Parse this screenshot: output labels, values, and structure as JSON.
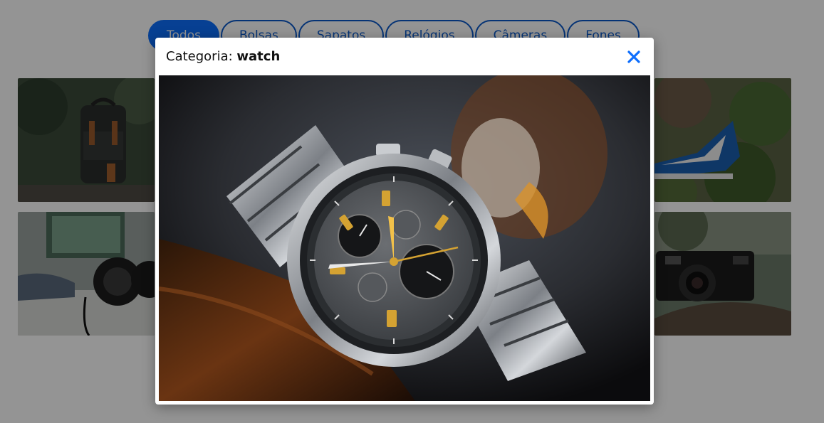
{
  "filters": [
    {
      "label": "Todos",
      "active": true
    },
    {
      "label": "Bolsas",
      "active": false
    },
    {
      "label": "Sapatos",
      "active": false
    },
    {
      "label": "Relógios",
      "active": false
    },
    {
      "label": "Câmeras",
      "active": false
    },
    {
      "label": "Fones",
      "active": false
    }
  ],
  "gallery": {
    "items": [
      {
        "category": "bag"
      },
      {
        "category": "headphones"
      },
      {
        "category": "shoes"
      },
      {
        "category": "camera"
      }
    ]
  },
  "modal": {
    "title_prefix": "Categoria:",
    "category": "watch",
    "close_icon": "close-icon",
    "image_subject": "wristwatch"
  },
  "colors": {
    "primary": "#0d6efd",
    "primary_border": "#0a58ca",
    "close": "#0d6efd"
  }
}
